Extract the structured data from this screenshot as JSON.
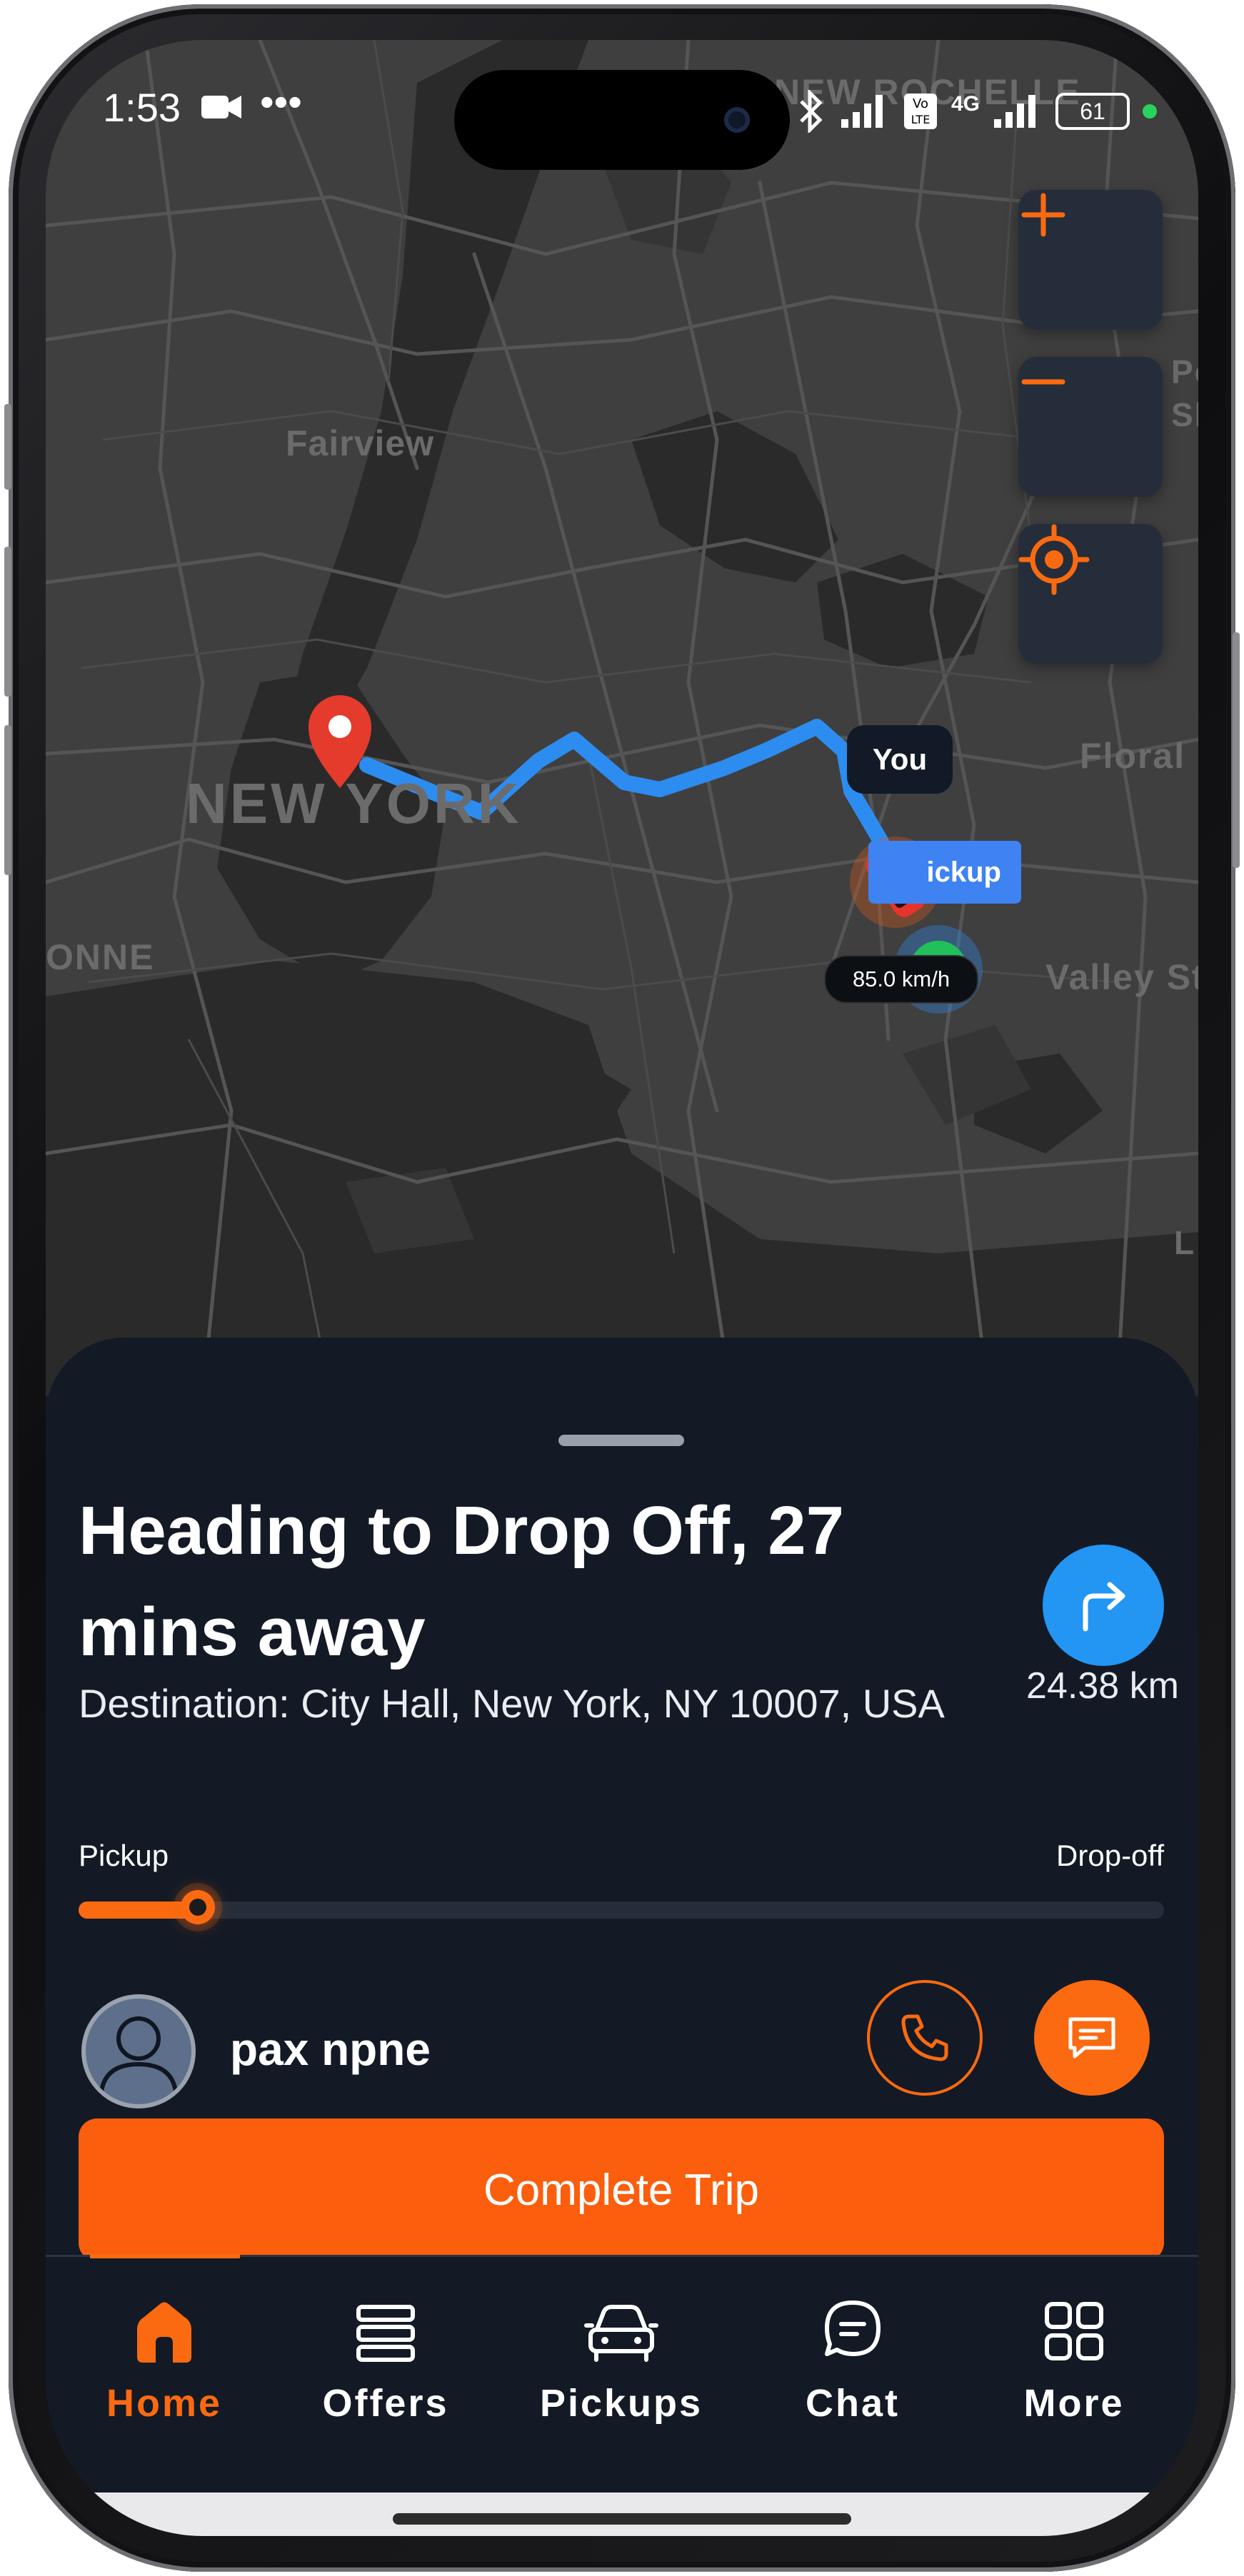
{
  "status_bar": {
    "time": "1:53",
    "network": "4G",
    "battery": "61"
  },
  "map": {
    "labels": {
      "fairview": "Fairview",
      "new_york": "NEW YORK",
      "new_rochelle": "NEW ROCHELLE",
      "floral": "Floral P",
      "valley": "Valley St",
      "onne": "ONNE",
      "po": "Po",
      "sh": "Sh",
      "l": "L"
    },
    "you_label": "You",
    "pickup_label": "ickup",
    "speed": "85.0 km/h",
    "colors": {
      "route": "#2d8cf0",
      "accent": "#fb6a10",
      "pin": "#e53b2c"
    }
  },
  "trip": {
    "heading": "Heading to Drop Off, 27 mins away",
    "destination": "Destination: City Hall, New York, NY 10007, USA",
    "distance": "24.38 km",
    "progress_start_label": "Pickup",
    "progress_end_label": "Drop-off",
    "progress": 0.11
  },
  "passenger": {
    "name": "pax npne"
  },
  "actions": {
    "complete_label": "Complete Trip"
  },
  "tabs": [
    {
      "label": "Home",
      "icon": "home-icon",
      "active": true
    },
    {
      "label": "Offers",
      "icon": "list-icon",
      "active": false
    },
    {
      "label": "Pickups",
      "icon": "car-icon",
      "active": false
    },
    {
      "label": "Chat",
      "icon": "chat-icon",
      "active": false
    },
    {
      "label": "More",
      "icon": "grid-icon",
      "active": false
    }
  ]
}
